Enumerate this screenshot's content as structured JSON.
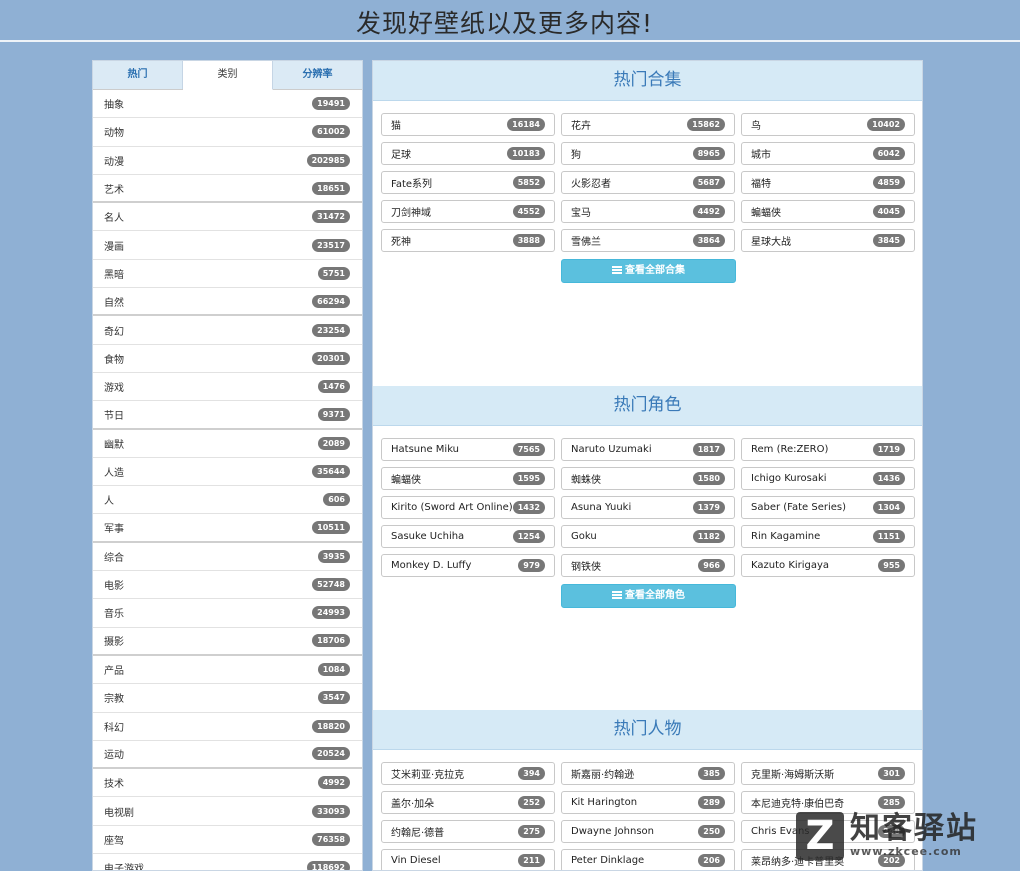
{
  "header": {
    "title": "发现好壁纸以及更多内容!"
  },
  "left": {
    "tabs": [
      {
        "label": "热门"
      },
      {
        "label": "类别"
      },
      {
        "label": "分辨率"
      }
    ],
    "categories": [
      {
        "name": "抽象",
        "count": "19491"
      },
      {
        "name": "动物",
        "count": "61002"
      },
      {
        "name": "动漫",
        "count": "202985"
      },
      {
        "name": "艺术",
        "count": "18651"
      },
      {
        "name": "名人",
        "count": "31472"
      },
      {
        "name": "漫画",
        "count": "23517"
      },
      {
        "name": "黑暗",
        "count": "5751"
      },
      {
        "name": "自然",
        "count": "66294"
      },
      {
        "name": "奇幻",
        "count": "23254"
      },
      {
        "name": "食物",
        "count": "20301"
      },
      {
        "name": "游戏",
        "count": "1476"
      },
      {
        "name": "节日",
        "count": "9371"
      },
      {
        "name": "幽默",
        "count": "2089"
      },
      {
        "name": "人造",
        "count": "35644"
      },
      {
        "name": "人",
        "count": "606"
      },
      {
        "name": "军事",
        "count": "10511"
      },
      {
        "name": "综合",
        "count": "3935"
      },
      {
        "name": "电影",
        "count": "52748"
      },
      {
        "name": "音乐",
        "count": "24993"
      },
      {
        "name": "摄影",
        "count": "18706"
      },
      {
        "name": "产品",
        "count": "1084"
      },
      {
        "name": "宗教",
        "count": "3547"
      },
      {
        "name": "科幻",
        "count": "18820"
      },
      {
        "name": "运动",
        "count": "20524"
      },
      {
        "name": "技术",
        "count": "4992"
      },
      {
        "name": "电视剧",
        "count": "33093"
      },
      {
        "name": "座驾",
        "count": "76358"
      },
      {
        "name": "电子游戏",
        "count": "118692"
      }
    ]
  },
  "sections": [
    {
      "title": "热门合集",
      "button": "查看全部合集",
      "items": [
        {
          "name": "猫",
          "count": "16184"
        },
        {
          "name": "花卉",
          "count": "15862"
        },
        {
          "name": "鸟",
          "count": "10402"
        },
        {
          "name": "足球",
          "count": "10183"
        },
        {
          "name": "狗",
          "count": "8965"
        },
        {
          "name": "城市",
          "count": "6042"
        },
        {
          "name": "Fate系列",
          "count": "5852"
        },
        {
          "name": "火影忍者",
          "count": "5687"
        },
        {
          "name": "福特",
          "count": "4859"
        },
        {
          "name": "刀剑神域",
          "count": "4552"
        },
        {
          "name": "宝马",
          "count": "4492"
        },
        {
          "name": "蝙蝠侠",
          "count": "4045"
        },
        {
          "name": "死神",
          "count": "3888"
        },
        {
          "name": "雪佛兰",
          "count": "3864"
        },
        {
          "name": "星球大战",
          "count": "3845"
        }
      ]
    },
    {
      "title": "热门角色",
      "button": "查看全部角色",
      "items": [
        {
          "name": "Hatsune Miku",
          "count": "7565"
        },
        {
          "name": "Naruto Uzumaki",
          "count": "1817"
        },
        {
          "name": "Rem (Re:ZERO)",
          "count": "1719"
        },
        {
          "name": "蝙蝠侠",
          "count": "1595"
        },
        {
          "name": "蜘蛛侠",
          "count": "1580"
        },
        {
          "name": "Ichigo Kurosaki",
          "count": "1436"
        },
        {
          "name": "Kirito (Sword Art Online)",
          "count": "1432"
        },
        {
          "name": "Asuna Yuuki",
          "count": "1379"
        },
        {
          "name": "Saber (Fate Series)",
          "count": "1304"
        },
        {
          "name": "Sasuke Uchiha",
          "count": "1254"
        },
        {
          "name": "Goku",
          "count": "1182"
        },
        {
          "name": "Rin Kagamine",
          "count": "1151"
        },
        {
          "name": "Monkey D. Luffy",
          "count": "979"
        },
        {
          "name": "钢铁侠",
          "count": "966"
        },
        {
          "name": "Kazuto Kirigaya",
          "count": "955"
        }
      ]
    },
    {
      "title": "热门人物",
      "items": [
        {
          "name": "艾米莉亚·克拉克",
          "count": "394"
        },
        {
          "name": "斯嘉丽·约翰逊",
          "count": "385"
        },
        {
          "name": "克里斯·海姆斯沃斯",
          "count": "301"
        },
        {
          "name": "盖尔·加朵",
          "count": "252"
        },
        {
          "name": "Kit Harington",
          "count": "289"
        },
        {
          "name": "本尼迪克特·康伯巴奇",
          "count": "285"
        },
        {
          "name": "约翰尼·德普",
          "count": "275"
        },
        {
          "name": "Dwayne Johnson",
          "count": "250"
        },
        {
          "name": "Chris Evans",
          "count": "248"
        },
        {
          "name": "Vin Diesel",
          "count": "211"
        },
        {
          "name": "Peter Dinklage",
          "count": "206"
        },
        {
          "name": "莱昂纳多·迪卡普里奥",
          "count": "202"
        }
      ]
    }
  ],
  "watermark": {
    "logo": "Z",
    "title": "知客驿站",
    "url": "www.zkcee.com"
  }
}
